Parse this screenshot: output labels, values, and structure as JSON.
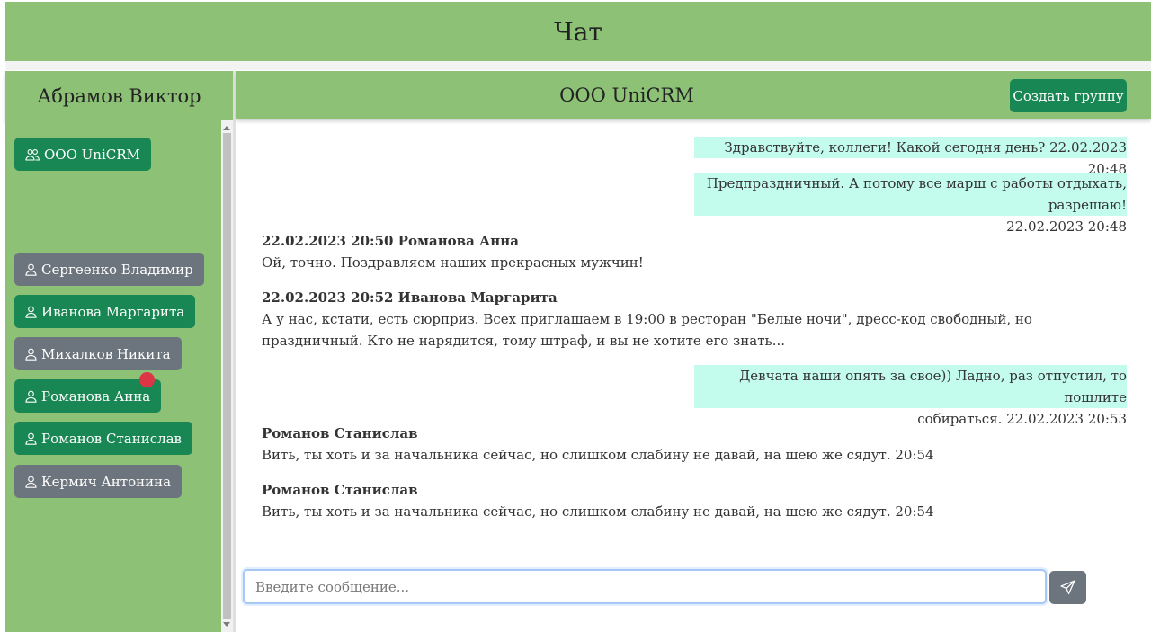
{
  "header": {
    "title": "Чат"
  },
  "sidebar": {
    "user_name": "Абрамов Виктор",
    "group": {
      "label": "ООО UniCRM",
      "icon": "people-icon"
    },
    "contacts": [
      {
        "label": "Сергеенко Владимир",
        "style": "gray"
      },
      {
        "label": "Иванова Маргарита",
        "style": "green"
      },
      {
        "label": "Михалков Никита",
        "style": "gray"
      },
      {
        "label": "Романова Анна",
        "style": "green",
        "unread": true
      },
      {
        "label": "Романов Станислав",
        "style": "green"
      },
      {
        "label": "Кермич Антонина",
        "style": "gray"
      }
    ]
  },
  "chat": {
    "title": "ООО UniCRM",
    "create_group_label": "Создать группу",
    "messages": [
      {
        "type": "out",
        "lines": [
          "Здравствуйте, коллеги! Какой сегодня день? 22.02.2023 20:48"
        ]
      },
      {
        "type": "out",
        "lines": [
          "Предпраздничный. А потому все марш с работы отдыхать, разрешаю!",
          "22.02.2023 20:48"
        ]
      },
      {
        "type": "in",
        "meta": "22.02.2023 20:50 Романова Анна",
        "text": "Ой, точно. Поздравляем наших прекрасных мужчин!"
      },
      {
        "type": "in",
        "meta": "22.02.2023 20:52 Иванова Маргарита",
        "text": "А у нас, кстати, есть сюрприз. Всех приглашаем в 19:00 в ресторан \"Белые ночи\", дресс-код свободный, но праздничный. Кто не нарядится, тому штраф, и вы не хотите его знать..."
      },
      {
        "type": "out",
        "lines": [
          "Девчата наши опять за свое)) Ладно, раз отпустил, то пошлите",
          "собираться. 22.02.2023 20:53"
        ]
      },
      {
        "type": "in",
        "meta": "Романов Станислав",
        "text": "Вить, ты хоть и за начальника сейчас, но слишком слабину не давай, на шею же сядут. 20:54"
      },
      {
        "type": "in",
        "meta": "Романов Станислав",
        "text": "Вить, ты хоть и за начальника сейчас, но слишком слабину не давай, на шею же сядут. 20:54"
      }
    ],
    "input_placeholder": "Введите сообщение...",
    "send_icon": "send-icon"
  },
  "colors": {
    "header_bg": "#8cc176",
    "button_green": "#198754",
    "button_gray": "#6c757d",
    "outgoing_bubble": "#c3fced",
    "unread_dot": "#dc3545"
  }
}
